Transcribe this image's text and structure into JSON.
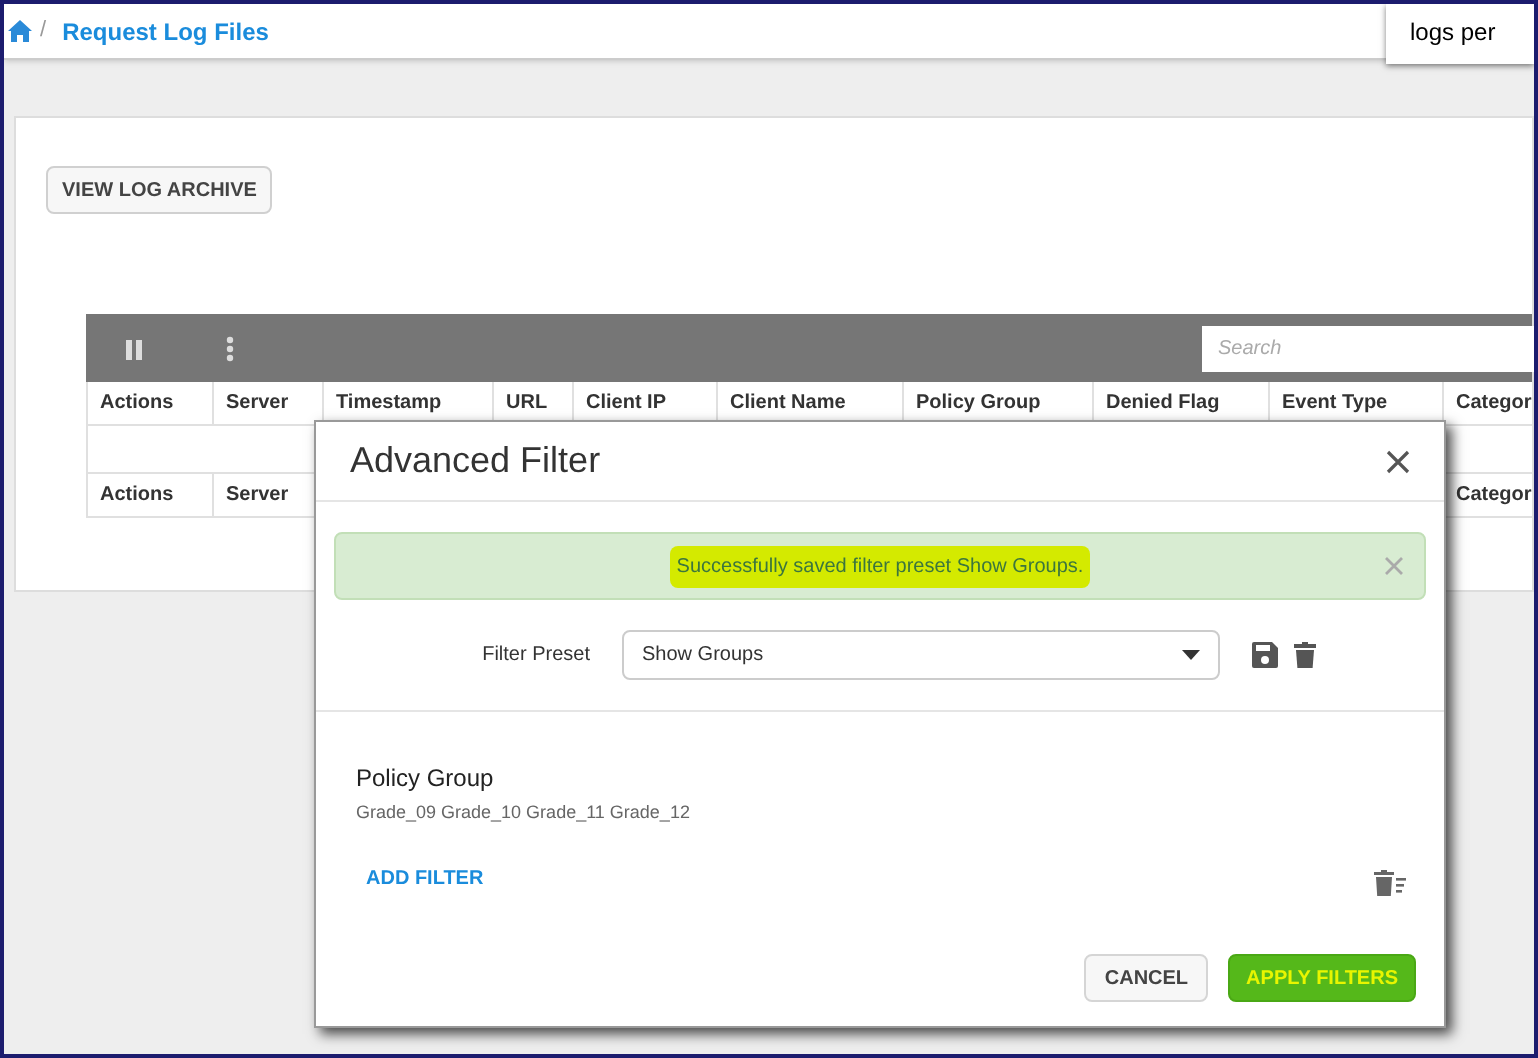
{
  "breadcrumb": {
    "separator": "/",
    "current": "Request Log Files"
  },
  "popup": {
    "text": "logs per"
  },
  "archive_button": "VIEW LOG ARCHIVE",
  "table": {
    "search": {
      "placeholder": "Search"
    },
    "columns": [
      "Actions",
      "Server",
      "Timestamp",
      "URL",
      "Client IP",
      "Client Name",
      "Policy Group",
      "Denied Flag",
      "Event Type",
      "Categor"
    ],
    "footer_columns": [
      "Actions",
      "Server",
      "Categor"
    ]
  },
  "dialog": {
    "title": "Advanced Filter",
    "alert": {
      "text": "Successfully saved filter preset Show Groups.",
      "highlighted": true
    },
    "preset": {
      "label": "Filter Preset",
      "value": "Show Groups"
    },
    "filters": [
      {
        "name": "Policy Group",
        "values": "Grade_09 Grade_10 Grade_11 Grade_12"
      }
    ],
    "add_filter": "ADD FILTER",
    "buttons": [
      {
        "label": "CANCEL",
        "kind": "secondary"
      },
      {
        "label": "APPLY FILTERS",
        "kind": "primary"
      }
    ]
  }
}
